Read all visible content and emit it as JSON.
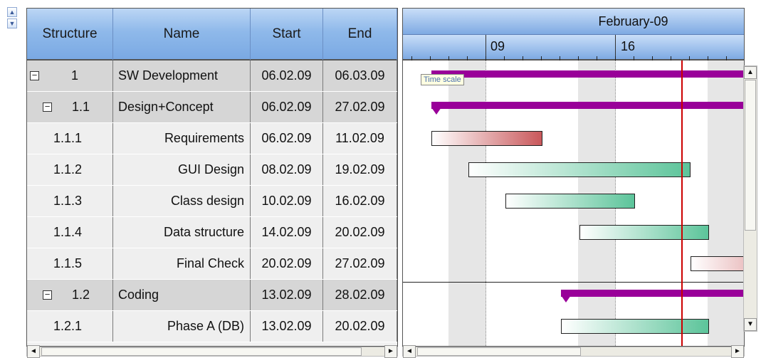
{
  "side_buttons": {
    "up": "▲",
    "down": "▼"
  },
  "columns": [
    {
      "key": "structure",
      "label": "Structure"
    },
    {
      "key": "name",
      "label": "Name"
    },
    {
      "key": "start",
      "label": "Start"
    },
    {
      "key": "end",
      "label": "End"
    }
  ],
  "rows": [
    {
      "structure": "1",
      "name": "SW Development",
      "start": "06.02.09",
      "end": "06.03.09",
      "level": "summary",
      "expander": "−"
    },
    {
      "structure": "1.1",
      "name": "Design+Concept",
      "start": "06.02.09",
      "end": "27.02.09",
      "level": "subsummary",
      "expander": "−"
    },
    {
      "structure": "1.1.1",
      "name": "Requirements",
      "start": "06.02.09",
      "end": "11.02.09",
      "level": "task"
    },
    {
      "structure": "1.1.2",
      "name": "GUI Design",
      "start": "08.02.09",
      "end": "19.02.09",
      "level": "task"
    },
    {
      "structure": "1.1.3",
      "name": "Class design",
      "start": "10.02.09",
      "end": "16.02.09",
      "level": "task"
    },
    {
      "structure": "1.1.4",
      "name": "Data structure",
      "start": "14.02.09",
      "end": "20.02.09",
      "level": "task"
    },
    {
      "structure": "1.1.5",
      "name": "Final Check",
      "start": "20.02.09",
      "end": "27.02.09",
      "level": "task"
    },
    {
      "structure": "1.2",
      "name": "Coding",
      "start": "13.02.09",
      "end": "28.02.09",
      "level": "subsummary",
      "expander": "−"
    },
    {
      "structure": "1.2.1",
      "name": "Phase A (DB)",
      "start": "13.02.09",
      "end": "20.02.09",
      "level": "task"
    }
  ],
  "gantt": {
    "month_label": "February-09",
    "week_labels": [
      "09",
      "16"
    ],
    "tooltip": "Time scale",
    "today_line_color": "#cc0000",
    "summary_color": "#990099",
    "red_bar_color": "#c9585b",
    "green_bar_color": "#5cc49a"
  },
  "scroll": {
    "left": "◄",
    "right": "►",
    "up": "▲",
    "down": "▼"
  }
}
